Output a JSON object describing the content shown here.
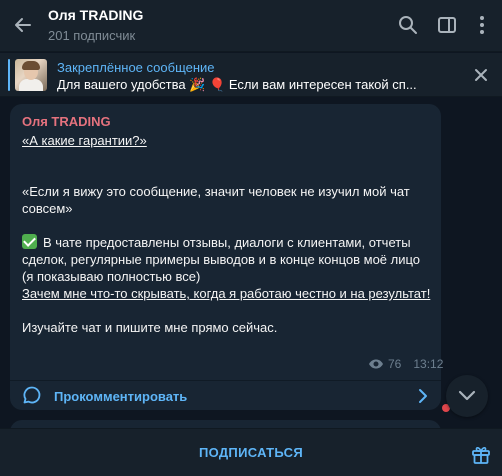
{
  "header": {
    "title": "Оля TRADING",
    "subscribers": "201 подписчик",
    "icons": [
      "back-arrow-icon",
      "search-icon",
      "sidebar-toggle-icon",
      "more-vertical-icon"
    ]
  },
  "pinned": {
    "title": "Закреплённое сообщение",
    "text": "Для вашего удобства 🎉 🎈 Если вам интересен такой сп..."
  },
  "message": {
    "author": "Оля TRADING",
    "heading": "«А какие гарантии?»",
    "p1": "«Если я вижу это сообщение, значит человек не изучил мой чат совсем»",
    "p2": "В чате предоставлены отзывы, диалоги с клиентами, отчеты сделок, регулярные примеры выводов и в конце концов моё лицо (я показываю полностью все)",
    "p3": "Зачем мне что-то скрывать, когда я работаю честно и на результат!",
    "p4": "Изучайте чат и пишите мне прямо сейчас.",
    "views": "76",
    "time": "13:12",
    "comments_label": "Прокомментировать"
  },
  "bottom": {
    "subscribe_label": "ПОДПИСАТЬСЯ"
  },
  "colors": {
    "accent": "#5eb5f7",
    "author": "#e5727e",
    "background": "#0e1621",
    "panel": "#17212b",
    "bubble": "#182533"
  }
}
